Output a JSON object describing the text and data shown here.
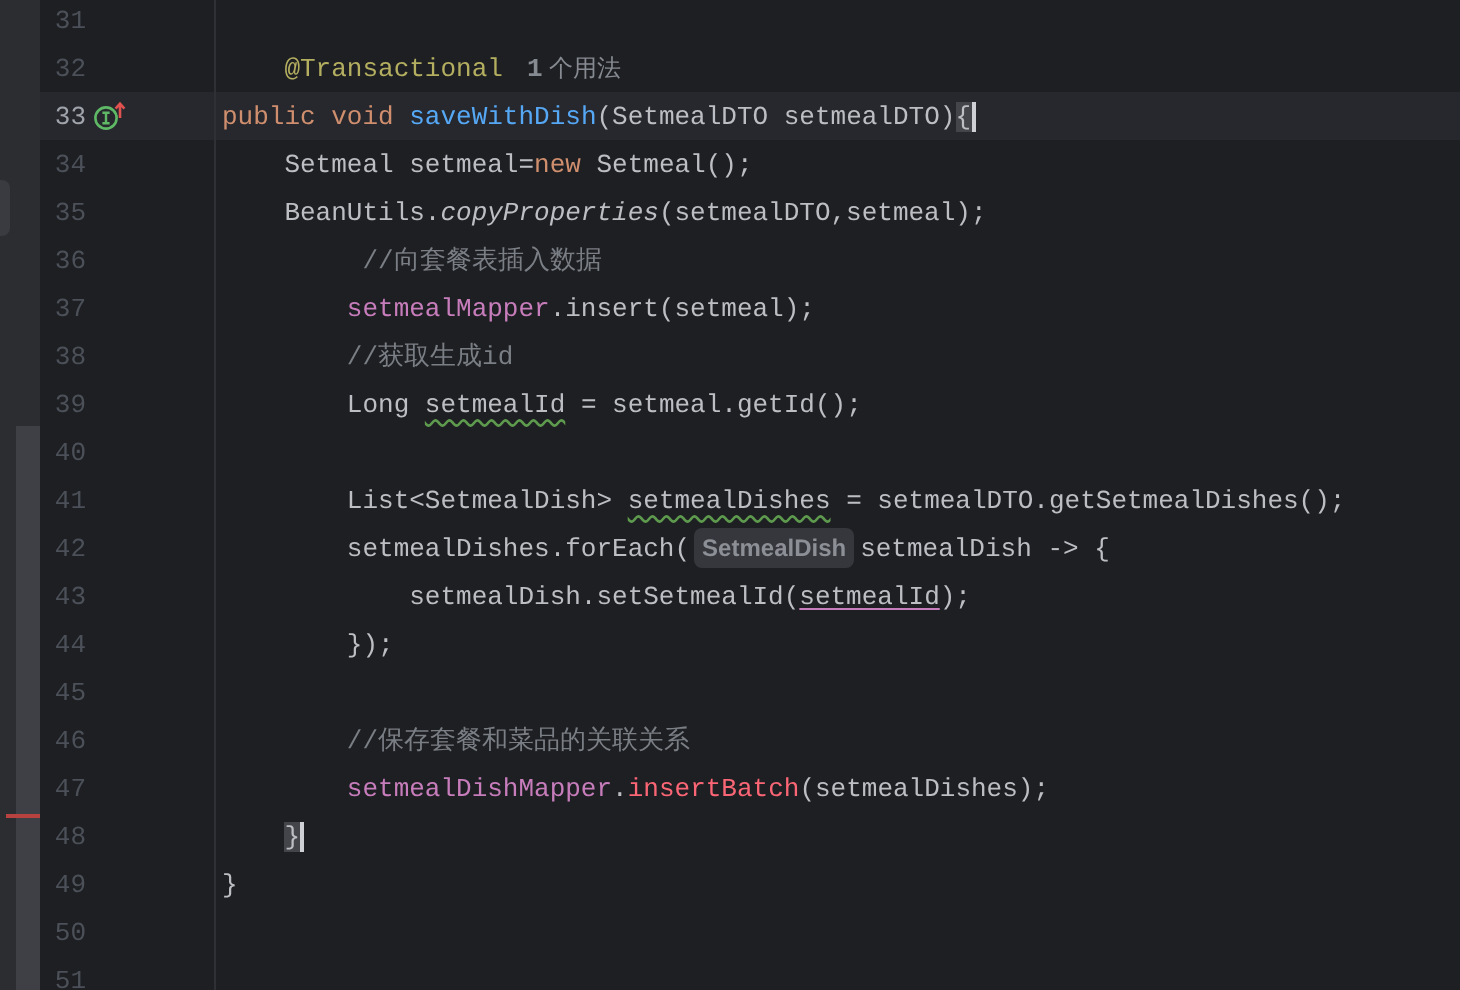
{
  "editor": {
    "lines": [
      {
        "number": "31",
        "current": false
      },
      {
        "number": "32",
        "current": false,
        "tokens": [
          {
            "text": "    @Transactional",
            "kind": "annotation"
          },
          {
            "text": "**1** 个用法",
            "kind": "usage_hint"
          }
        ]
      },
      {
        "number": "33",
        "current": true,
        "implementation_marker": true,
        "tokens": [
          {
            "text": "public void ",
            "kind": "keyword"
          },
          {
            "text": "saveWithDish",
            "kind": "method_decl"
          },
          {
            "text": "(SetmealDTO setmealDTO)",
            "kind": "plain"
          },
          {
            "text": "{",
            "kind": "brace_match"
          }
        ]
      },
      {
        "number": "34",
        "current": false,
        "tokens": [
          {
            "text": "    Setmeal setmeal=",
            "kind": "plain"
          },
          {
            "text": "new ",
            "kind": "keyword"
          },
          {
            "text": "Setmeal();",
            "kind": "plain"
          }
        ]
      },
      {
        "number": "35",
        "current": false,
        "tokens": [
          {
            "text": "    BeanUtils.",
            "kind": "plain"
          },
          {
            "text": "copyProperties",
            "kind": "static_call"
          },
          {
            "text": "(setmealDTO,setmeal);",
            "kind": "plain"
          }
        ]
      },
      {
        "number": "36",
        "current": false,
        "tokens": [
          {
            "text": "         //向套餐表插入数据",
            "kind": "comment"
          }
        ]
      },
      {
        "number": "37",
        "current": false,
        "tokens": [
          {
            "text": "        setmealMapper",
            "kind": "field"
          },
          {
            "text": ".insert(setmeal);",
            "kind": "plain"
          }
        ]
      },
      {
        "number": "38",
        "current": false,
        "tokens": [
          {
            "text": "        //获取生成id",
            "kind": "comment"
          }
        ]
      },
      {
        "number": "39",
        "current": false,
        "tokens": [
          {
            "text": "        Long ",
            "kind": "plain"
          },
          {
            "text": "setmealId",
            "kind": "warning"
          },
          {
            "text": " = setmeal.getId();",
            "kind": "plain"
          }
        ]
      },
      {
        "number": "40",
        "current": false
      },
      {
        "number": "41",
        "current": false,
        "tokens": [
          {
            "text": "        List<SetmealDish> ",
            "kind": "plain"
          },
          {
            "text": "setmealDishes",
            "kind": "warning"
          },
          {
            "text": " = setmealDTO.getSetmealDishes();",
            "kind": "plain"
          }
        ]
      },
      {
        "number": "42",
        "current": false,
        "tokens": [
          {
            "text": "        setmealDishes.forEach(",
            "kind": "plain"
          },
          {
            "text": "SetmealDish",
            "kind": "inlay_hint"
          },
          {
            "text": "setmealDish -> {",
            "kind": "plain"
          }
        ]
      },
      {
        "number": "43",
        "current": false,
        "tokens": [
          {
            "text": "            setmealDish.setSetmealId(",
            "kind": "plain"
          },
          {
            "text": "setmealId",
            "kind": "captured"
          },
          {
            "text": ");",
            "kind": "plain"
          }
        ]
      },
      {
        "number": "44",
        "current": false,
        "tokens": [
          {
            "text": "        });",
            "kind": "plain"
          }
        ]
      },
      {
        "number": "45",
        "current": false
      },
      {
        "number": "46",
        "current": false,
        "tokens": [
          {
            "text": "        //保存套餐和菜品的关联关系",
            "kind": "comment"
          }
        ]
      },
      {
        "number": "47",
        "current": false,
        "tokens": [
          {
            "text": "        setmealDishMapper",
            "kind": "field"
          },
          {
            "text": ".",
            "kind": "plain"
          },
          {
            "text": "insertBatch",
            "kind": "error_call"
          },
          {
            "text": "(setmealDishes);",
            "kind": "plain"
          }
        ]
      },
      {
        "number": "48",
        "current": false,
        "tokens": [
          {
            "text": "    }",
            "kind": "brace_match"
          }
        ]
      },
      {
        "number": "49",
        "current": false,
        "tokens": [
          {
            "text": "}",
            "kind": "plain"
          }
        ]
      },
      {
        "number": "50",
        "current": false
      },
      {
        "number": "51",
        "current": false
      }
    ]
  }
}
